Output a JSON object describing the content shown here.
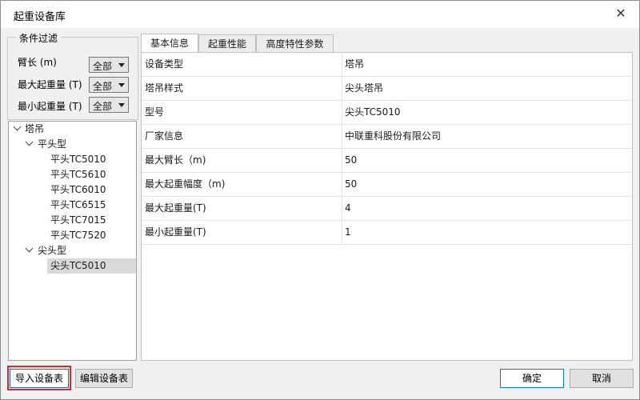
{
  "window": {
    "title": "起重设备库",
    "close_glyph": "✕"
  },
  "filter": {
    "legend": "条件过滤",
    "rows": [
      {
        "label": "臂长 (m)",
        "value": "全部"
      },
      {
        "label": "最大起重量 (T)",
        "value": "全部"
      },
      {
        "label": "最小起重量 (T)",
        "value": "全部"
      }
    ]
  },
  "tree": {
    "root": "塔吊",
    "groups": [
      {
        "label": "平头型",
        "items": [
          "平头TC5010",
          "平头TC5610",
          "平头TC6010",
          "平头TC6515",
          "平头TC7015",
          "平头TC7520"
        ]
      },
      {
        "label": "尖头型",
        "items": [
          "尖头TC5010"
        ]
      }
    ],
    "selected": "尖头TC5010"
  },
  "tabs": [
    "基本信息",
    "起重性能",
    "高度特性参数"
  ],
  "active_tab": "基本信息",
  "properties": [
    {
      "key": "设备类型",
      "value": "塔吊"
    },
    {
      "key": "塔吊样式",
      "value": "尖头塔吊"
    },
    {
      "key": "型号",
      "value": "尖头TC5010"
    },
    {
      "key": "厂家信息",
      "value": "中联重科股份有限公司"
    },
    {
      "key": "最大臂长（m)",
      "value": "50"
    },
    {
      "key": "最大起重幅度（m)",
      "value": "50"
    },
    {
      "key": "最大起重量(T)",
      "value": "4"
    },
    {
      "key": "最小起重量(T)",
      "value": "1"
    }
  ],
  "buttons": {
    "import": "导入设备表",
    "edit": "编辑设备表",
    "ok": "确定",
    "cancel": "取消"
  },
  "colors": {
    "highlight": "#e0262c",
    "primary_border": "#0078d7",
    "selection": "#d9d9d9"
  }
}
